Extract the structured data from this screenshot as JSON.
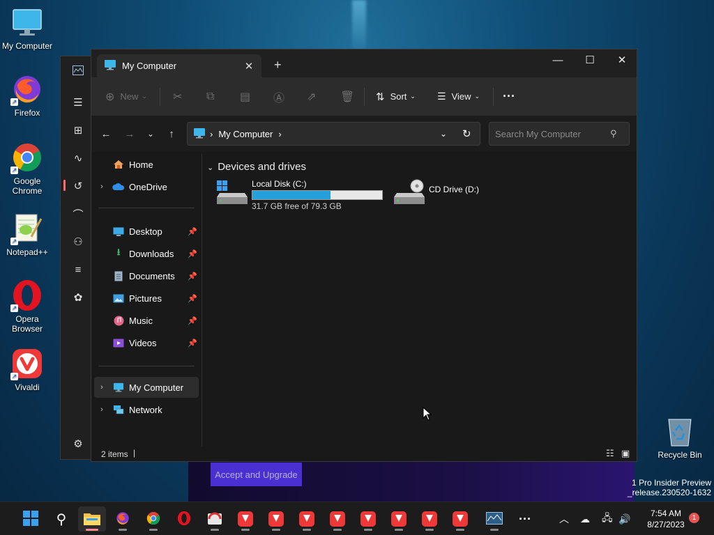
{
  "desktop": {
    "icons": [
      {
        "label": "My Computer",
        "icon": "monitor-icon"
      },
      {
        "label": "Firefox",
        "icon": "firefox-icon"
      },
      {
        "label": "Google Chrome",
        "icon": "chrome-icon"
      },
      {
        "label": "Notepad++",
        "icon": "notepadpp-icon"
      },
      {
        "label": "Opera Browser",
        "icon": "opera-icon"
      },
      {
        "label": "Vivaldi",
        "icon": "vivaldi-icon"
      }
    ],
    "recycle_bin": "Recycle Bin",
    "watermark_line1": "1 Pro Insider Preview",
    "watermark_line2": "_release.230520-1632"
  },
  "background_app": {
    "upgrade_button": "Accept and Upgrade"
  },
  "explorer": {
    "tab_title": "My Computer",
    "toolbar": {
      "new": "New",
      "sort": "Sort",
      "view": "View",
      "more": "···"
    },
    "address": {
      "location": "My Computer"
    },
    "search_placeholder": "Search My Computer",
    "nav": {
      "home": "Home",
      "onedrive": "OneDrive",
      "pinned": [
        "Desktop",
        "Downloads",
        "Documents",
        "Pictures",
        "Music",
        "Videos"
      ],
      "my_computer": "My Computer",
      "network": "Network"
    },
    "content": {
      "group_header": "Devices and drives",
      "drives": [
        {
          "name": "Local Disk (C:)",
          "free_text": "31.7 GB free of 79.3 GB",
          "used_fraction": 0.6
        },
        {
          "name": "CD Drive (D:)"
        }
      ]
    },
    "status": {
      "items": "2 items"
    }
  },
  "taskbar": {
    "time": "7:54 AM",
    "date": "8/27/2023",
    "notification_count": "1"
  },
  "colors": {
    "accent": "#26a0da",
    "upgrade": "#4a2fd1"
  }
}
